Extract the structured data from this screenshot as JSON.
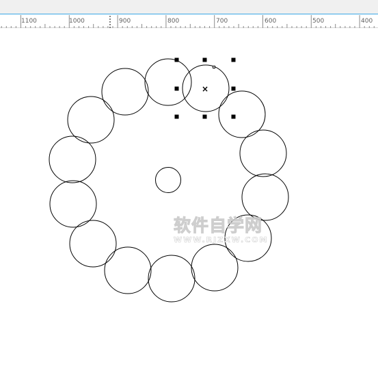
{
  "ruler": {
    "labels": [
      "1100",
      "1000",
      "900",
      "800",
      "700",
      "600",
      "500",
      "400"
    ]
  },
  "selection": {
    "center_marker": "×"
  },
  "watermark": {
    "main": "软件自学网",
    "sub": "WWW.RJZXW.COM"
  },
  "colors": {
    "ruler_accent": "#38a7e6",
    "stroke": "#000000",
    "handle": "#000000"
  }
}
